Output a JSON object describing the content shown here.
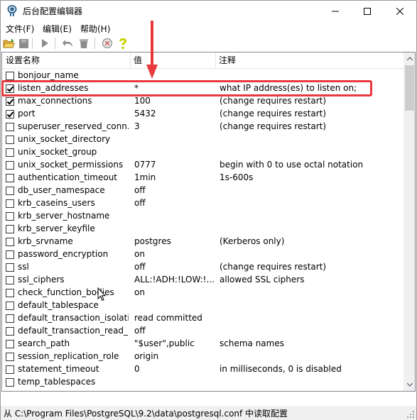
{
  "window": {
    "title": "后台配置编辑器",
    "controls": {
      "minimize": "—",
      "maximize": "☐",
      "close": "✕"
    }
  },
  "menu": [
    {
      "label": "文件(F)"
    },
    {
      "label": "编辑(E)"
    },
    {
      "label": "帮助(H)"
    }
  ],
  "toolbar": {
    "buttons": [
      "open-folder-icon",
      "save-icon",
      "play-icon",
      "undo-icon",
      "delete-icon",
      "plugin-icon",
      "help-icon"
    ]
  },
  "list": {
    "columns": {
      "name": "设置名称",
      "value": "值",
      "note": "注释"
    },
    "rows": [
      {
        "checked": false,
        "name": "bonjour_name",
        "value": "",
        "note": ""
      },
      {
        "checked": true,
        "name": "listen_addresses",
        "value": "*",
        "note": "what IP address(es) to listen on;"
      },
      {
        "checked": true,
        "name": "max_connections",
        "value": "100",
        "note": "(change requires restart)"
      },
      {
        "checked": true,
        "name": "port",
        "value": "5432",
        "note": "(change requires restart)"
      },
      {
        "checked": false,
        "name": "superuser_reserved_conn...",
        "value": "3",
        "note": "(change requires restart)"
      },
      {
        "checked": false,
        "name": "unix_socket_directory",
        "value": "",
        "note": ""
      },
      {
        "checked": false,
        "name": "unix_socket_group",
        "value": "",
        "note": ""
      },
      {
        "checked": false,
        "name": "unix_socket_permissions",
        "value": "0777",
        "note": "begin with 0 to use octal notation"
      },
      {
        "checked": false,
        "name": "authentication_timeout",
        "value": "1min",
        "note": "1s-600s"
      },
      {
        "checked": false,
        "name": "db_user_namespace",
        "value": "off",
        "note": ""
      },
      {
        "checked": false,
        "name": "krb_caseins_users",
        "value": "off",
        "note": ""
      },
      {
        "checked": false,
        "name": "krb_server_hostname",
        "value": "",
        "note": ""
      },
      {
        "checked": false,
        "name": "krb_server_keyfile",
        "value": "",
        "note": ""
      },
      {
        "checked": false,
        "name": "krb_srvname",
        "value": "postgres",
        "note": "(Kerberos only)"
      },
      {
        "checked": false,
        "name": "password_encryption",
        "value": "on",
        "note": ""
      },
      {
        "checked": false,
        "name": "ssl",
        "value": "off",
        "note": "(change requires restart)"
      },
      {
        "checked": false,
        "name": "ssl_ciphers",
        "value": "ALL:!ADH:!LOW:!...",
        "note": "allowed SSL ciphers"
      },
      {
        "checked": false,
        "name": "check_function_bodies",
        "value": "on",
        "note": ""
      },
      {
        "checked": false,
        "name": "default_tablespace",
        "value": "",
        "note": ""
      },
      {
        "checked": false,
        "name": "default_transaction_isolation",
        "value": "read committed",
        "note": ""
      },
      {
        "checked": false,
        "name": "default_transaction_read_...",
        "value": "off",
        "note": ""
      },
      {
        "checked": false,
        "name": "search_path",
        "value": "\"$user\",public",
        "note": "schema names"
      },
      {
        "checked": false,
        "name": "session_replication_role",
        "value": "origin",
        "note": ""
      },
      {
        "checked": false,
        "name": "statement_timeout",
        "value": "0",
        "note": "in milliseconds, 0 is disabled"
      },
      {
        "checked": false,
        "name": "temp_tablespaces",
        "value": "",
        "note": ""
      }
    ]
  },
  "status": {
    "text": "从 C:\\Program Files\\PostgreSQL\\9.2\\data\\postgresql.conf 中读取配置"
  },
  "colors": {
    "highlight": "#e8393d",
    "border": "#828790"
  }
}
